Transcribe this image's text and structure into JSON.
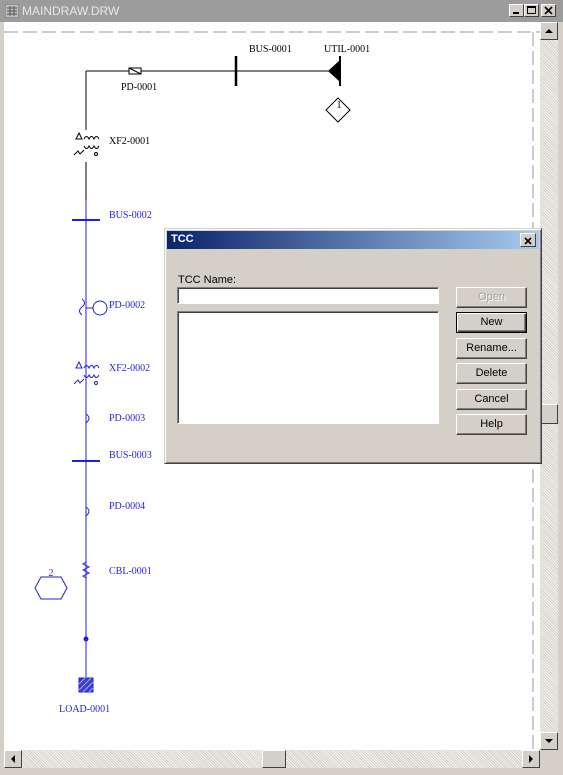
{
  "window": {
    "title": "MAINDRAW.DRW",
    "controls": {
      "minimize": "minimize-icon",
      "maximize": "maximize-icon",
      "close": "close-icon"
    }
  },
  "diagram": {
    "labels": {
      "bus_0001": "BUS-0001",
      "util_0001": "UTIL-0001",
      "pd_0001": "PD-0001",
      "xf2_0001": "XF2-0001",
      "bus_0002": "BUS-0002",
      "pd_0002": "PD-0002",
      "xf2_0002": "XF2-0002",
      "pd_0003": "PD-0003",
      "bus_0003": "BUS-0003",
      "pd_0004": "PD-0004",
      "cbl_0001": "CBL-0001",
      "load_0001": "LOAD-0001"
    },
    "markers": {
      "util_marker": "1",
      "cable_marker": "2"
    },
    "colors": {
      "energized": "#1f1fdc",
      "upstream": "#000000"
    }
  },
  "dialog": {
    "title": "TCC",
    "name_label": "TCC Name:",
    "name_value": "",
    "buttons": {
      "open": "Open",
      "new": "New",
      "rename": "Rename...",
      "delete": "Delete",
      "cancel": "Cancel",
      "help": "Help"
    },
    "open_enabled": false,
    "default_button": "New"
  },
  "scrollbars": {
    "vertical": "vertical-scrollbar",
    "horizontal": "horizontal-scrollbar"
  }
}
